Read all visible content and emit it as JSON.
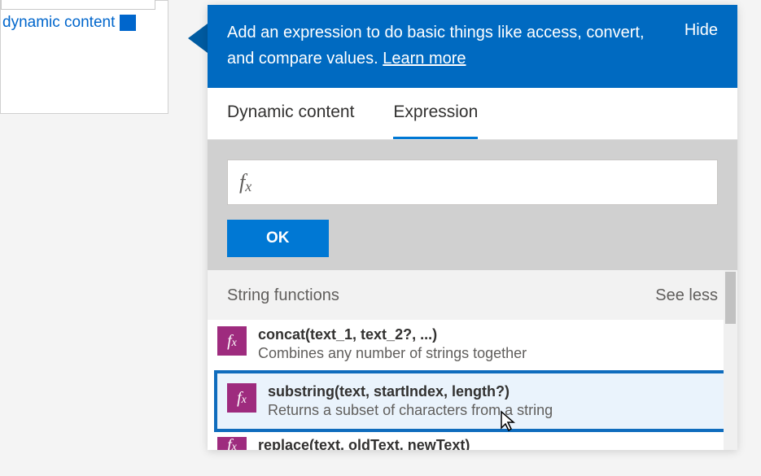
{
  "left": {
    "dynamic_content_label": "dynamic content",
    "plus_glyph": "+"
  },
  "flyout": {
    "header_text": "Add an expression to do basic things like access, convert, and compare values. ",
    "learn_more": "Learn more",
    "hide": "Hide"
  },
  "tabs": {
    "dynamic": "Dynamic content",
    "expression": "Expression"
  },
  "input": {
    "fx_label": "fx",
    "ok_label": "OK"
  },
  "section": {
    "title": "String functions",
    "see_less": "See less"
  },
  "functions": [
    {
      "signature": "concat(text_1, text_2?, ...)",
      "description": "Combines any number of strings together"
    },
    {
      "signature": "substring(text, startIndex, length?)",
      "description": "Returns a subset of characters from a string"
    },
    {
      "signature": "replace(text, oldText, newText)",
      "description": ""
    }
  ]
}
